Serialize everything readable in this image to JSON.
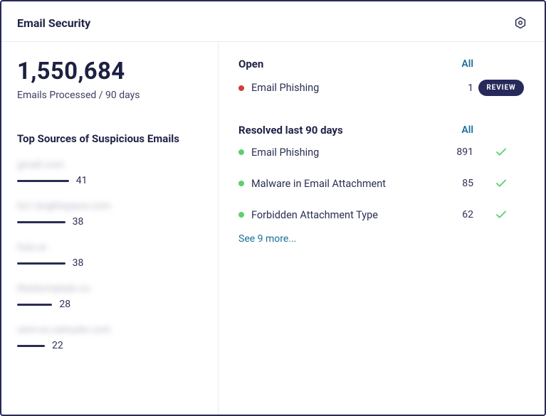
{
  "header": {
    "title": "Email Security"
  },
  "stats": {
    "emails_processed": "1,550,684",
    "period_label": "Emails Processed / 90 days"
  },
  "sources": {
    "title": "Top Sources of Suspicious Emails",
    "items": [
      {
        "name": "gmail.com",
        "value": 41,
        "bar_pct": 28
      },
      {
        "name": "hs1.brightspace.com",
        "value": 38,
        "bar_pct": 26
      },
      {
        "name": "hulu.ai",
        "value": 38,
        "bar_pct": 26
      },
      {
        "name": "thedormptale.co",
        "value": 28,
        "bar_pct": 19
      },
      {
        "name": "sem-no.netsuite.com",
        "value": 22,
        "bar_pct": 15
      }
    ]
  },
  "open": {
    "title": "Open",
    "all_label": "All",
    "items": [
      {
        "label": "Email Phishing",
        "count": 1,
        "dot": "red",
        "action": "REVIEW"
      }
    ]
  },
  "resolved": {
    "title": "Resolved last 90 days",
    "all_label": "All",
    "items": [
      {
        "label": "Email Phishing",
        "count": 891,
        "dot": "green",
        "status": "check"
      },
      {
        "label": "Malware in Email Attachment",
        "count": 85,
        "dot": "green",
        "status": "check"
      },
      {
        "label": "Forbidden Attachment Type",
        "count": 62,
        "dot": "green",
        "status": "check"
      }
    ],
    "see_more": "See 9 more..."
  }
}
